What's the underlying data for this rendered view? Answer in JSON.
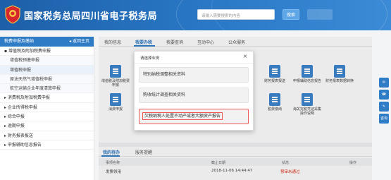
{
  "header": {
    "title": "国家税务总局四川省电子税务局",
    "search_placeholder": "请输入需要搜索的内容",
    "search_button": "搜索"
  },
  "sidebar": {
    "head_label": "税费申报及缴纳",
    "back_label": "◂ 返回主页",
    "items": [
      {
        "label": "▪ 增值税及附加税费申报",
        "sub": false
      },
      {
        "label": "增值税预缴申报",
        "sub": true
      },
      {
        "label": "增值税申报",
        "sub": true
      },
      {
        "label": "原油天然气增值税申报",
        "sub": true
      },
      {
        "label": "航空运输企业年度清算申报",
        "sub": true
      },
      {
        "label": "▸ 消费税及附加税费申报",
        "sub": false
      },
      {
        "label": "▸ 企业所得税申报",
        "sub": false
      },
      {
        "label": "▸ 综合申报",
        "sub": false
      },
      {
        "label": "▸ 逾期申报",
        "sub": false
      },
      {
        "label": "▸ 财务报表报送",
        "sub": false
      },
      {
        "label": "▸ 申报辅助信息报告",
        "sub": false
      }
    ]
  },
  "tabs": [
    {
      "label": "我的信息"
    },
    {
      "label": "我要办税"
    },
    {
      "label": "我要查询"
    },
    {
      "label": "互动中心"
    },
    {
      "label": "公众服务"
    }
  ],
  "func_items": [
    {
      "label": "增值税及附加税费申报",
      "icon": "form-icon"
    },
    {
      "label": "消费申报",
      "icon": "form-icon"
    },
    {
      "label": "财务报表报送",
      "icon": "form-icon"
    },
    {
      "label": "申报辅助信息报告",
      "icon": "form-icon"
    },
    {
      "label": "财务报表数据转换",
      "icon": "form-icon"
    },
    {
      "label": "税费缴纳",
      "icon": "form-icon"
    },
    {
      "label": "税收减免",
      "icon": "form-icon"
    },
    {
      "label": "海关完税凭证采集操作说明",
      "icon": "form-icon"
    }
  ],
  "section": {
    "tabs": [
      "我的待办",
      "服务提醒"
    ],
    "columns": [
      "事项名称",
      "截止日期",
      "状态",
      "操作"
    ],
    "rows": [
      {
        "name": "发票领用",
        "date": "2018-11-06 14:44:47",
        "status": "预审未通过",
        "action": ""
      }
    ]
  },
  "float_buttons": [
    "",
    "",
    "",
    "咨询"
  ],
  "modal": {
    "title": "请选择业务",
    "close": "×",
    "options": [
      "特别纳税调整相关资料",
      "购收统计调查相关资料",
      "欠税纳税人处置不动产或者大额资产报告"
    ]
  }
}
